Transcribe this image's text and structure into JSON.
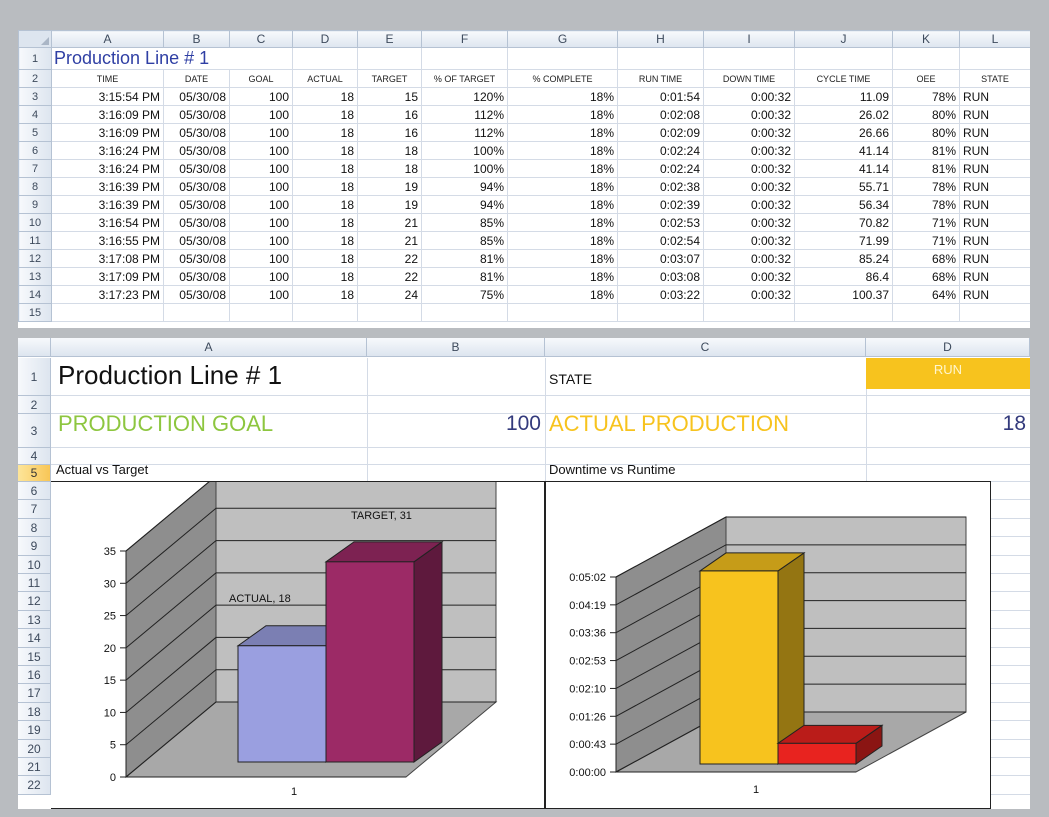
{
  "colors": {
    "goal": "#8dc63f",
    "actual": "#f7c31e",
    "number": "#333a7c",
    "run_fill": "#f7c31e"
  },
  "sheet1": {
    "columns": [
      "A",
      "B",
      "C",
      "D",
      "E",
      "F",
      "G",
      "H",
      "I",
      "J",
      "K",
      "L"
    ],
    "title": "Production Line # 1",
    "headers": [
      "TIME",
      "DATE",
      "GOAL",
      "ACTUAL",
      "TARGET",
      "% OF TARGET",
      "% COMPLETE",
      "RUN TIME",
      "DOWN TIME",
      "CYCLE TIME",
      "OEE",
      "STATE"
    ],
    "rows": [
      [
        "3:15:54 PM",
        "05/30/08",
        "100",
        "18",
        "15",
        "120%",
        "18%",
        "0:01:54",
        "0:00:32",
        "11.09",
        "78%",
        "RUN"
      ],
      [
        "3:16:09 PM",
        "05/30/08",
        "100",
        "18",
        "16",
        "112%",
        "18%",
        "0:02:08",
        "0:00:32",
        "26.02",
        "80%",
        "RUN"
      ],
      [
        "3:16:09 PM",
        "05/30/08",
        "100",
        "18",
        "16",
        "112%",
        "18%",
        "0:02:09",
        "0:00:32",
        "26.66",
        "80%",
        "RUN"
      ],
      [
        "3:16:24 PM",
        "05/30/08",
        "100",
        "18",
        "18",
        "100%",
        "18%",
        "0:02:24",
        "0:00:32",
        "41.14",
        "81%",
        "RUN"
      ],
      [
        "3:16:24 PM",
        "05/30/08",
        "100",
        "18",
        "18",
        "100%",
        "18%",
        "0:02:24",
        "0:00:32",
        "41.14",
        "81%",
        "RUN"
      ],
      [
        "3:16:39 PM",
        "05/30/08",
        "100",
        "18",
        "19",
        "94%",
        "18%",
        "0:02:38",
        "0:00:32",
        "55.71",
        "78%",
        "RUN"
      ],
      [
        "3:16:39 PM",
        "05/30/08",
        "100",
        "18",
        "19",
        "94%",
        "18%",
        "0:02:39",
        "0:00:32",
        "56.34",
        "78%",
        "RUN"
      ],
      [
        "3:16:54 PM",
        "05/30/08",
        "100",
        "18",
        "21",
        "85%",
        "18%",
        "0:02:53",
        "0:00:32",
        "70.82",
        "71%",
        "RUN"
      ],
      [
        "3:16:55 PM",
        "05/30/08",
        "100",
        "18",
        "21",
        "85%",
        "18%",
        "0:02:54",
        "0:00:32",
        "71.99",
        "71%",
        "RUN"
      ],
      [
        "3:17:08 PM",
        "05/30/08",
        "100",
        "18",
        "22",
        "81%",
        "18%",
        "0:03:07",
        "0:00:32",
        "85.24",
        "68%",
        "RUN"
      ],
      [
        "3:17:09 PM",
        "05/30/08",
        "100",
        "18",
        "22",
        "81%",
        "18%",
        "0:03:08",
        "0:00:32",
        "86.4",
        "68%",
        "RUN"
      ],
      [
        "3:17:23 PM",
        "05/30/08",
        "100",
        "18",
        "24",
        "75%",
        "18%",
        "0:03:22",
        "0:00:32",
        "100.37",
        "64%",
        "RUN"
      ]
    ],
    "row_numbers": [
      "1",
      "2",
      "3",
      "4",
      "5",
      "6",
      "7",
      "8",
      "9",
      "10",
      "11",
      "12",
      "13",
      "14",
      "15"
    ]
  },
  "sheet2": {
    "columns": [
      "A",
      "B",
      "C",
      "D"
    ],
    "row_numbers": [
      "1",
      "2",
      "3",
      "4",
      "5",
      "6",
      "7",
      "8",
      "9",
      "10",
      "11",
      "12",
      "13",
      "14",
      "15",
      "16",
      "17",
      "18",
      "19",
      "20",
      "21",
      "22"
    ],
    "title": "Production Line # 1",
    "state_label": "STATE",
    "state_value": "RUN",
    "goal_label": "PRODUCTION GOAL",
    "goal_value": "100",
    "actual_label": "ACTUAL PRODUCTION",
    "actual_value": "18",
    "chart1_title": "Actual vs Target",
    "chart2_title": "Downtime vs Runtime"
  },
  "chart_data": [
    {
      "type": "bar",
      "categories": [
        "1"
      ],
      "series": [
        {
          "name": "ACTUAL",
          "values": [
            18
          ],
          "color": "#9a9fe0"
        },
        {
          "name": "TARGET",
          "values": [
            31
          ],
          "color": "#9c2a66"
        }
      ],
      "data_labels": [
        "ACTUAL, 18",
        "TARGET, 31"
      ],
      "yticks": [
        "0",
        "5",
        "10",
        "15",
        "20",
        "25",
        "30",
        "35"
      ],
      "ylim": [
        0,
        35
      ],
      "grid": true
    },
    {
      "type": "bar",
      "categories": [
        "1"
      ],
      "series": [
        {
          "values": [
            299
          ],
          "color": "#f7c31e"
        },
        {
          "values": [
            32
          ],
          "color": "#e8231f"
        }
      ],
      "yticks": [
        "0:00:00",
        "0:00:43",
        "0:01:26",
        "0:02:10",
        "0:02:53",
        "0:03:36",
        "0:04:19",
        "0:05:02"
      ],
      "ylim": [
        0,
        302
      ],
      "grid": true
    }
  ]
}
